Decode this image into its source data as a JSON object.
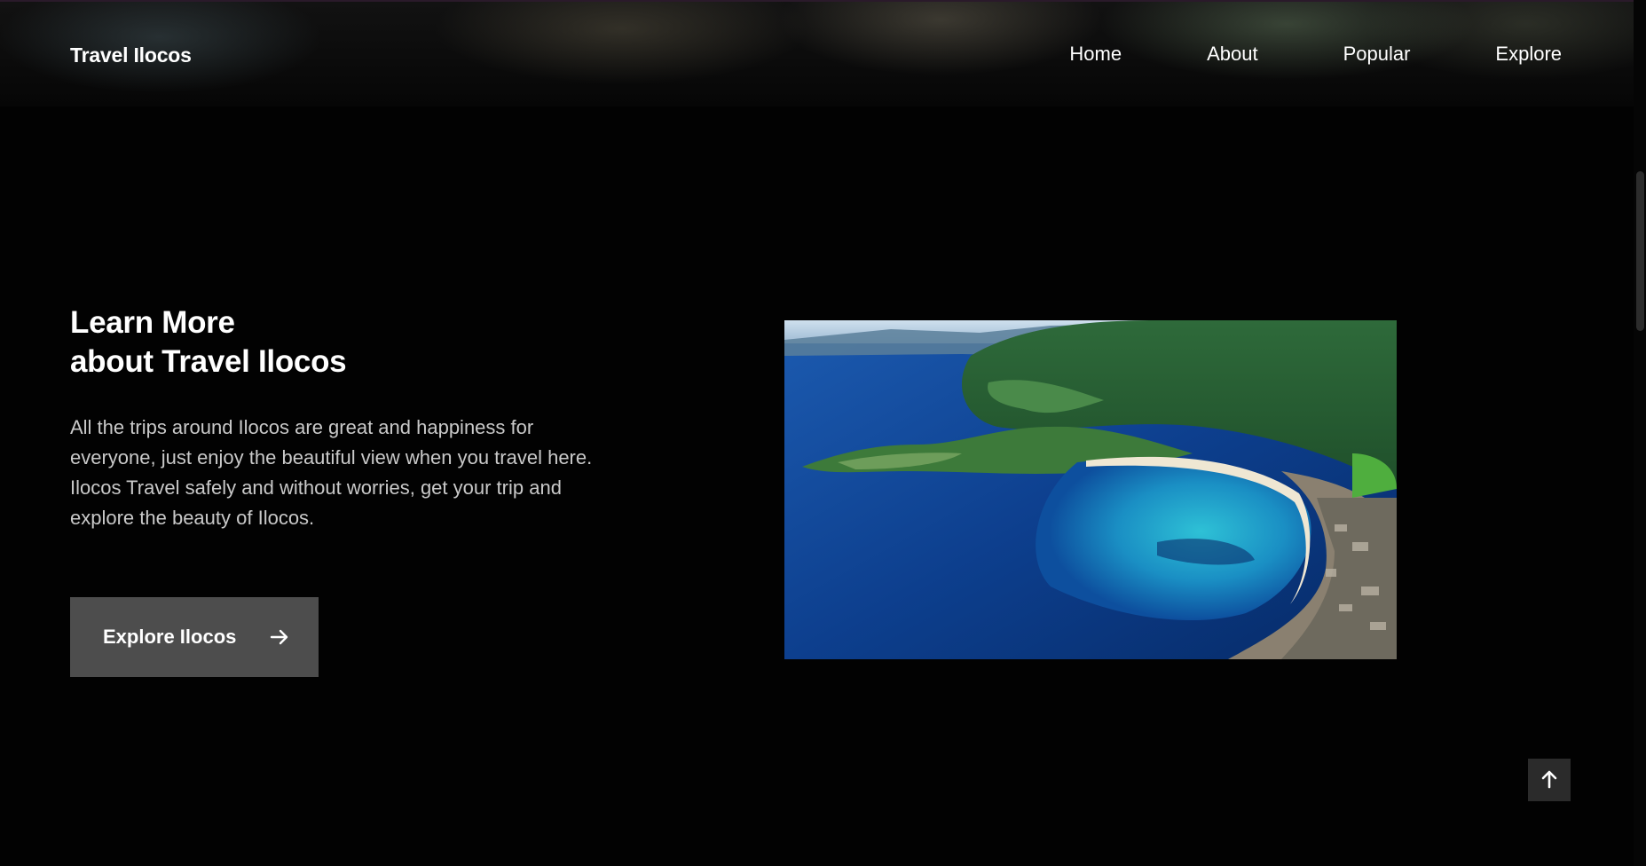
{
  "header": {
    "logo": "Travel Ilocos",
    "nav": [
      {
        "label": "Home"
      },
      {
        "label": "About"
      },
      {
        "label": "Popular"
      },
      {
        "label": "Explore"
      }
    ]
  },
  "about": {
    "title_line1": "Learn More",
    "title_line2": "about Travel Ilocos",
    "description": "All the trips around Ilocos are great and happiness for everyone, just enjoy the beautiful view when you travel here. Ilocos Travel safely and without worries, get your trip and explore the beauty of Ilocos.",
    "button_label": "Explore Ilocos",
    "button_icon": "arrow-right-icon",
    "image_subject": "aerial view of coastal bay"
  },
  "scroll_top": {
    "icon": "arrow-up-icon"
  },
  "colors": {
    "background": "#020202",
    "button_bg": "#4d4d4d",
    "scroll_top_bg": "#2b2b2b",
    "text_muted": "#c9c9c9"
  }
}
